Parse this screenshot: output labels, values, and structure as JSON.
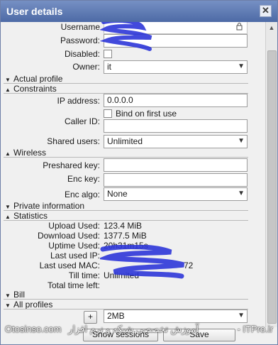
{
  "window": {
    "title": "User details"
  },
  "colors": {
    "title_bar": "#5b78b5",
    "scribble": "#2d36d8"
  },
  "fields": {
    "username_label": "Username",
    "password_label": "Password:",
    "disabled_label": "Disabled:",
    "owner_label": "Owner:",
    "owner_value": "it"
  },
  "sections": {
    "actual_profile": "Actual profile",
    "constraints": "Constraints",
    "wireless": "Wireless",
    "private_information": "Private information",
    "statistics": "Statistics",
    "bill": "Bill",
    "all_profiles": "All profiles"
  },
  "constraints": {
    "ip_label": "IP address:",
    "ip_value": "0.0.0.0",
    "bind_label": "Bind on first use",
    "caller_label": "Caller ID:",
    "caller_value": "",
    "shared_label": "Shared users:",
    "shared_value": "Unlimited"
  },
  "wireless": {
    "psk_label": "Preshared key:",
    "psk_value": "",
    "enckey_label": "Enc key:",
    "enckey_value": "",
    "encalgo_label": "Enc algo:",
    "encalgo_value": "None"
  },
  "statistics": {
    "upload_label": "Upload Used:",
    "upload_value": "123.4 MiB",
    "download_label": "Download Used:",
    "download_value": "1377.5 MiB",
    "uptime_label": "Uptime Used:",
    "uptime_value": "20h31m15s",
    "lastip_label": "Last used IP:",
    "lastmac_label": "Last used MAC:",
    "lastmac_value": "72",
    "till_label": "Till time:",
    "till_value": "Unlimited",
    "total_label": "Total time left:"
  },
  "profiles": {
    "add_label": "+",
    "profile_value": "2MB"
  },
  "footer": {
    "show_sessions": "Show sessions",
    "save": "Save"
  },
  "watermark": {
    "left": "Otosinso.com",
    "middle": "آموزش تخصصی شبکه و نرم افزار",
    "right": "- ITPro.ir"
  }
}
